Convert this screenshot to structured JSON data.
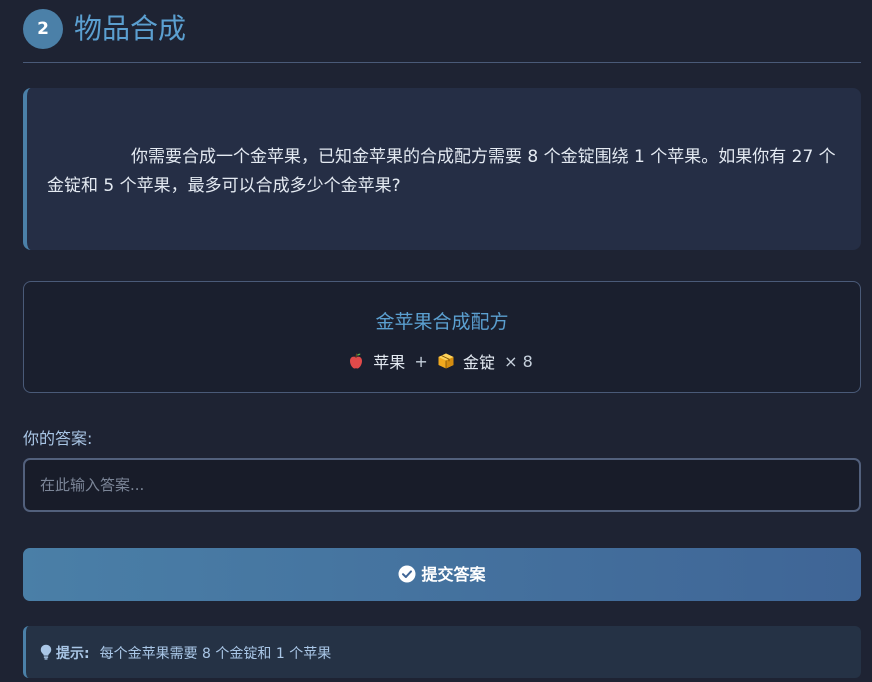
{
  "header": {
    "step_number": "2",
    "title": "物品合成"
  },
  "question": {
    "text": "你需要合成一个金苹果，已知金苹果的合成配方需要 8 个金锭围绕 1 个苹果。如果你有 27 个金锭和 5 个苹果，最多可以合成多少个金苹果?"
  },
  "recipe": {
    "title": "金苹果合成配方",
    "ingredient_1": "苹果",
    "ingredient_1_icon": "apple-icon",
    "plus": "+",
    "ingredient_2": "金锭",
    "ingredient_2_icon": "gold-ingot-icon",
    "multiplier": "× 8"
  },
  "answer": {
    "label": "你的答案:",
    "placeholder": "在此输入答案..."
  },
  "submit": {
    "label": "提交答案",
    "icon": "check-circle-icon"
  },
  "hint": {
    "label": "提示:",
    "text": "每个金苹果需要 8 个金锭和 1 个苹果",
    "icon": "lightbulb-icon"
  },
  "colors": {
    "background": "#1e2333",
    "accent": "#5b9fd0",
    "badge": "#4b80a8",
    "button_start": "#4a7fa7",
    "button_end": "#3f6596"
  }
}
